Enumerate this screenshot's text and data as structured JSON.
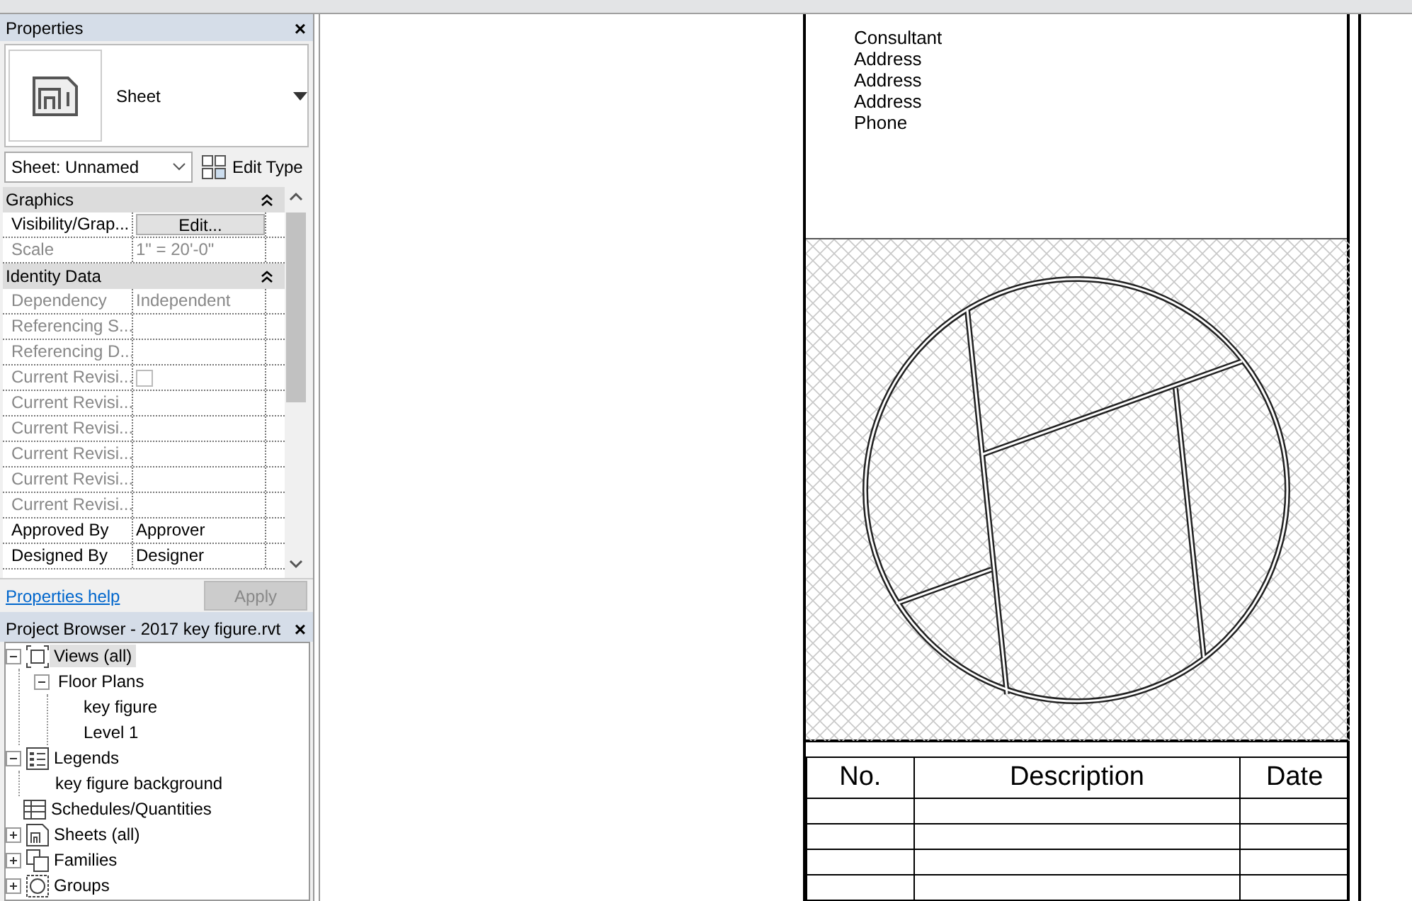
{
  "properties": {
    "title": "Properties",
    "close": "×",
    "type_name": "Sheet",
    "type_filter": "Sheet: Unnamed",
    "edit_type": "Edit Type",
    "rows": [
      {
        "kind": "group",
        "label": "Graphics",
        "expanded": true
      },
      {
        "kind": "button",
        "label": "Visibility/Grap...",
        "value": "Edit...",
        "disabled": false
      },
      {
        "kind": "text",
        "label": "Scale",
        "value": "1\" = 20'-0\"",
        "disabled": true
      },
      {
        "kind": "group",
        "label": "Identity Data",
        "expanded": true
      },
      {
        "kind": "text",
        "label": "Dependency",
        "value": "Independent",
        "disabled": true
      },
      {
        "kind": "text",
        "label": "Referencing S...",
        "disabled": true
      },
      {
        "kind": "text",
        "label": "Referencing D...",
        "disabled": true
      },
      {
        "kind": "checkbox",
        "label": "Current Revisi...",
        "checked": false,
        "disabled": true
      },
      {
        "kind": "text",
        "label": "Current Revisi...",
        "disabled": true
      },
      {
        "kind": "text",
        "label": "Current Revisi...",
        "disabled": true
      },
      {
        "kind": "text",
        "label": "Current Revisi...",
        "disabled": true
      },
      {
        "kind": "text",
        "label": "Current Revisi...",
        "disabled": true
      },
      {
        "kind": "text",
        "label": "Current Revisi...",
        "disabled": true
      },
      {
        "kind": "text",
        "label": "Approved By",
        "value": "Approver",
        "disabled": false
      },
      {
        "kind": "text",
        "label": "Designed By",
        "value": "Designer",
        "disabled": false
      }
    ],
    "help_link": "Properties help",
    "apply": "Apply",
    "apply_disabled": true
  },
  "project_browser": {
    "title": "Project Browser - 2017 key figure.rvt",
    "close": "×",
    "tree": [
      {
        "kind": "views",
        "label": "Views (all)",
        "selected": true,
        "expanded": true,
        "children": [
          {
            "label": "Floor Plans",
            "selected": false,
            "expanded": true,
            "children": [
              {
                "label": "key figure",
                "selected": false
              },
              {
                "label": "Level 1",
                "selected": false
              }
            ]
          }
        ]
      },
      {
        "kind": "legends",
        "label": "Legends",
        "selected": false,
        "expanded": true,
        "children": [
          {
            "label": "key figure background",
            "selected": false
          }
        ]
      },
      {
        "kind": "schedules",
        "label": "Schedules/Quantities",
        "selected": false
      },
      {
        "kind": "sheets",
        "label": "Sheets (all)",
        "selected": false,
        "expanded": false
      },
      {
        "kind": "families",
        "label": "Families",
        "selected": false,
        "expanded": false
      },
      {
        "kind": "groups",
        "label": "Groups",
        "selected": false,
        "expanded": false
      }
    ]
  },
  "sheet": {
    "consultant_lines": [
      "Consultant",
      "Address",
      "Address",
      "Address",
      "Phone"
    ],
    "revision_table": {
      "columns": [
        "No.",
        "Description",
        "Date"
      ],
      "rows": [
        {
          "kind": "blank"
        },
        {
          "kind": "blank"
        },
        {
          "kind": "blank"
        },
        {
          "kind": "blank"
        }
      ]
    }
  }
}
